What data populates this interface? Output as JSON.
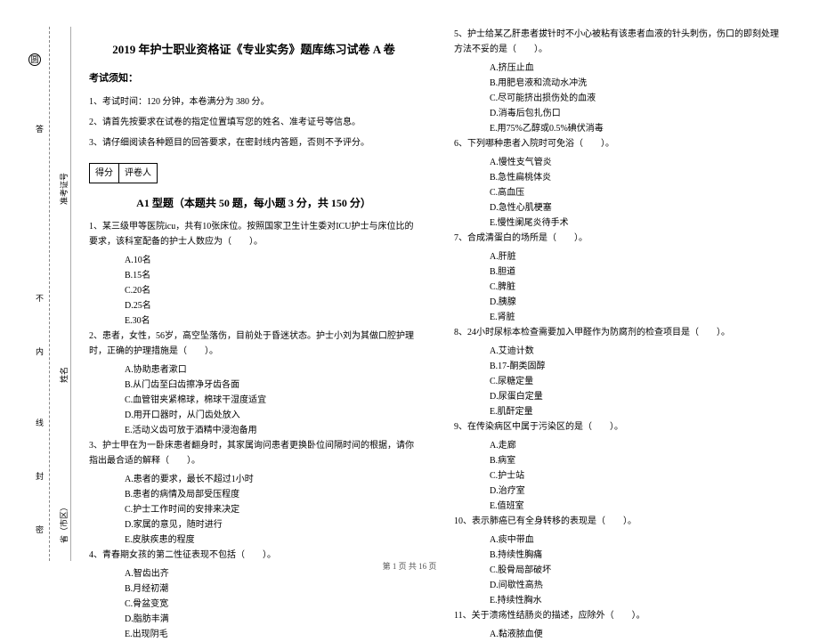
{
  "gutter": {
    "items": [
      "省（市区）",
      "姓名",
      "准考证号"
    ],
    "seal_marks": [
      "密",
      "封",
      "线",
      "内",
      "不",
      "答"
    ],
    "circle_top": "圆",
    "circle_bottom": "○"
  },
  "header": {
    "title": "2019 年护士职业资格证《专业实务》题库练习试卷 A 卷",
    "notice_label": "考试须知：",
    "instructions": [
      "1、考试时间：120 分钟，本卷满分为 380 分。",
      "2、请首先按要求在试卷的指定位置填写您的姓名、准考证号等信息。",
      "3、请仔细阅读各种题目的回答要求，在密封线内答题，否则不予评分。"
    ]
  },
  "score_box": {
    "score_label": "得分",
    "marker_label": "评卷人"
  },
  "part_a": {
    "title": "A1 型题（本题共 50 题，每小题 3 分，共 150 分）"
  },
  "questions_left": [
    {
      "stem": "1、某三级甲等医院icu，共有10张床位。按照国家卫生计生委对ICU护士与床位比的要求，该科室配备的护士人数应为（　　）。",
      "options": [
        "A.10名",
        "B.15名",
        "C.20名",
        "D.25名",
        "E.30名"
      ]
    },
    {
      "stem": "2、患者，女性，56岁，高空坠落伤，目前处于昏迷状态。护士小刘为其做口腔护理时，正确的护理措施是（　　）。",
      "options": [
        "A.协助患者漱口",
        "B.从门齿至臼齿擦净牙齿各面",
        "C.血管钳夹紧棉球，棉球干湿度适宜",
        "D.用开口器时，从门齿处放入",
        "E.活动义齿可放于酒精中浸泡备用"
      ]
    },
    {
      "stem": "3、护士甲在为一卧床患者翻身时，其家属询问患者更换卧位间隔时间的根据，请你指出最合适的解释（　　）。",
      "options": [
        "A.患者的要求，最长不超过1小时",
        "B.患者的病情及局部受压程度",
        "C.护士工作时间的安排来决定",
        "D.家属的意见，随时进行",
        "E.皮肤疾患的程度"
      ]
    },
    {
      "stem": "4、青春期女孩的第二性征表现不包括（　　）。",
      "options": [
        "A.智齿出齐",
        "B.月经初潮",
        "C.骨盆变宽",
        "D.脂肪丰满",
        "E.出现阴毛"
      ]
    }
  ],
  "questions_right": [
    {
      "stem": "5、护士给某乙肝患者拔针时不小心被粘有该患者血液的针头刺伤，伤口的即刻处理方法不妥的是（　　）。",
      "options": [
        "A.挤压止血",
        "B.用肥皂液和流动水冲洗",
        "C.尽可能挤出损伤处的血液",
        "D.消毒后包扎伤口",
        "E.用75%乙醇或0.5%碘伏消毒"
      ]
    },
    {
      "stem": "6、下列哪种患者入院时可免浴（　　）。",
      "options": [
        "A.慢性支气管炎",
        "B.急性扁桃体炎",
        "C.高血压",
        "D.急性心肌梗塞",
        "E.慢性阑尾炎待手术"
      ]
    },
    {
      "stem": "7、合成清蛋白的场所是（　　）。",
      "options": [
        "A.肝脏",
        "B.胆道",
        "C.脾脏",
        "D.胰腺",
        "E.肾脏"
      ]
    },
    {
      "stem": "8、24小时尿标本检查需要加入甲醛作为防腐剂的检查项目是（　　）。",
      "options": [
        "A.艾迪计数",
        "B.17-酮类固醇",
        "C.尿糖定量",
        "D.尿蛋白定量",
        "E.肌酐定量"
      ]
    },
    {
      "stem": "9、在传染病区中属于污染区的是（　　）。",
      "options": [
        "A.走廊",
        "B.病室",
        "C.护士站",
        "D.治疗室",
        "E.值班室"
      ]
    },
    {
      "stem": "10、表示肺癌已有全身转移的表现是（　　）。",
      "options": [
        "A.痰中带血",
        "B.持续性胸痛",
        "C.股骨局部破坏",
        "D.间歇性高热",
        "E.持续性胸水"
      ]
    },
    {
      "stem": "11、关于溃疡性结肠炎的描述，应除外（　　）。",
      "options": [
        "A.黏液脓血便"
      ]
    }
  ],
  "footer": {
    "text": "第 1 页 共 16 页"
  }
}
